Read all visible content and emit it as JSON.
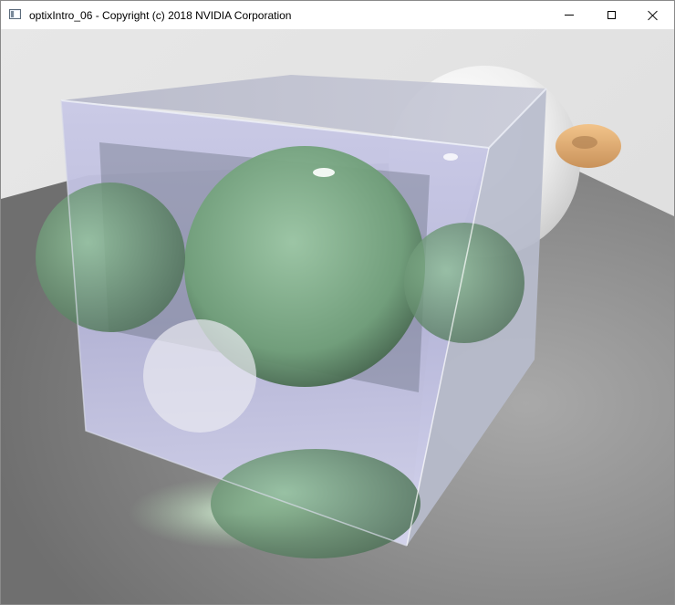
{
  "window": {
    "title": "optixIntro_06 - Copyright (c) 2018 NVIDIA Corporation",
    "icon": "app-window-icon",
    "controls": [
      "minimize-icon",
      "maximize-icon",
      "close-icon"
    ]
  },
  "viewport": {
    "content": "rendered-3d-scene"
  }
}
